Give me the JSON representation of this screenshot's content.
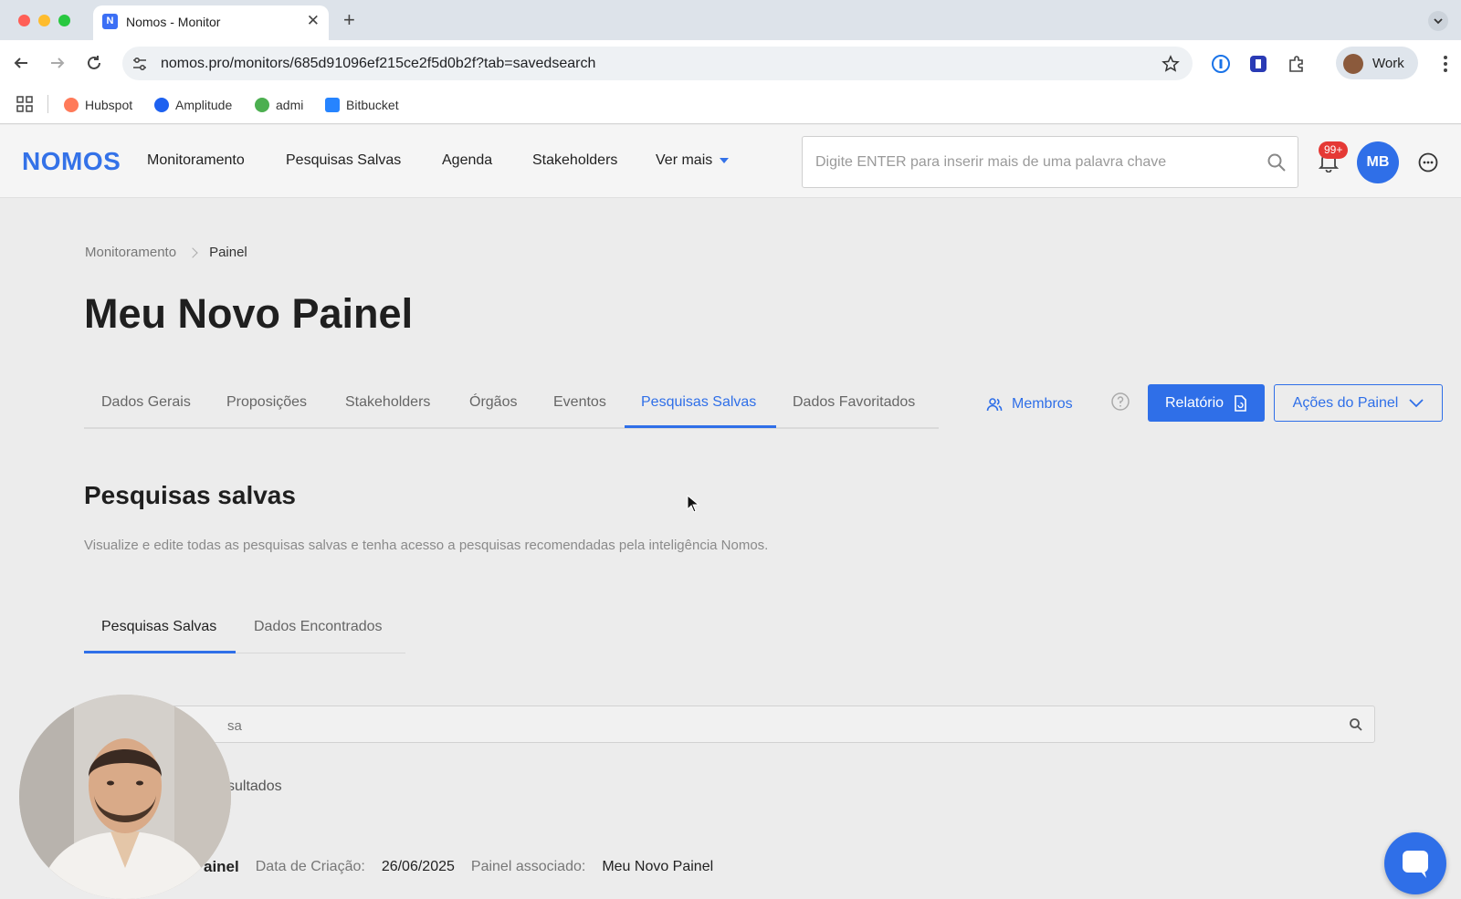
{
  "browser": {
    "tab_title": "Nomos - Monitor",
    "favicon_label": "N",
    "url": "nomos.pro/monitors/685d91096ef215ce2f5d0b2f?tab=savedsearch",
    "profile_label": "Work",
    "bookmarks": [
      "Hubspot",
      "Amplitude",
      "admi",
      "Bitbucket"
    ],
    "bookmark_colors": [
      "#ff7a59",
      "#1e61f0",
      "#4caf50",
      "#2684ff"
    ]
  },
  "header": {
    "logo": "NOMOS",
    "nav": [
      "Monitoramento",
      "Pesquisas Salvas",
      "Agenda",
      "Stakeholders",
      "Ver mais"
    ],
    "search_placeholder": "Digite ENTER para inserir mais de uma palavra chave",
    "notification_badge": "99+",
    "user_initials": "MB"
  },
  "breadcrumb": {
    "root": "Monitoramento",
    "current": "Painel"
  },
  "page_title": "Meu Novo Painel",
  "tabs": [
    "Dados Gerais",
    "Proposições",
    "Stakeholders",
    "Órgãos",
    "Eventos",
    "Pesquisas Salvas",
    "Dados Favoritados"
  ],
  "active_tab": "Pesquisas Salvas",
  "actions": {
    "members": "Membros",
    "report": "Relatório",
    "panel_actions": "Ações do Painel"
  },
  "section": {
    "title": "Pesquisas salvas",
    "description": "Visualize e edite todas as pesquisas salvas e tenha acesso a pesquisas recomendadas pela inteligência Nomos."
  },
  "subtabs": [
    "Pesquisas Salvas",
    "Dados Encontrados"
  ],
  "list": {
    "search_placeholder": "sa",
    "results_text": "sultados"
  },
  "saved_item": {
    "name": "ainel",
    "created_label": "Data de Criação:",
    "created_value": "26/06/2025",
    "panel_label": "Painel associado:",
    "panel_value": "Meu Novo Painel"
  },
  "colors": {
    "accent": "#2f6fe8",
    "badge": "#e53935"
  }
}
